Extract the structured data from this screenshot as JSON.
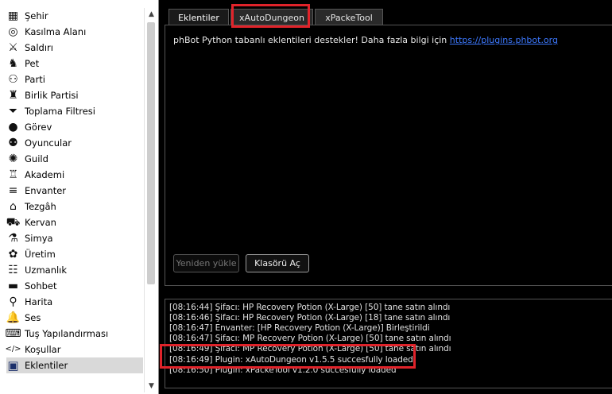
{
  "sidebar": {
    "items": [
      {
        "label": "Şehir",
        "icon": "city-icon"
      },
      {
        "label": "Kasılma Alanı",
        "icon": "target-icon"
      },
      {
        "label": "Saldırı",
        "icon": "sword-icon"
      },
      {
        "label": "Pet",
        "icon": "pet-icon"
      },
      {
        "label": "Parti",
        "icon": "party-icon"
      },
      {
        "label": "Birlik Partisi",
        "icon": "union-party-icon"
      },
      {
        "label": "Toplama Filtresi",
        "icon": "filter-icon"
      },
      {
        "label": "Görev",
        "icon": "quest-icon"
      },
      {
        "label": "Oyuncular",
        "icon": "players-icon"
      },
      {
        "label": "Guild",
        "icon": "guild-icon"
      },
      {
        "label": "Akademi",
        "icon": "academy-icon"
      },
      {
        "label": "Envanter",
        "icon": "inventory-icon"
      },
      {
        "label": "Tezgâh",
        "icon": "stall-icon"
      },
      {
        "label": "Kervan",
        "icon": "caravan-icon"
      },
      {
        "label": "Simya",
        "icon": "alchemy-icon"
      },
      {
        "label": "Üretim",
        "icon": "production-icon"
      },
      {
        "label": "Uzmanlık",
        "icon": "mastery-icon"
      },
      {
        "label": "Sohbet",
        "icon": "chat-icon"
      },
      {
        "label": "Harita",
        "icon": "map-pin-icon"
      },
      {
        "label": "Ses",
        "icon": "bell-icon"
      },
      {
        "label": "Tuş Yapılandırması",
        "icon": "hotkey-icon"
      },
      {
        "label": "Koşullar",
        "icon": "code-icon"
      },
      {
        "label": "Eklentiler",
        "icon": "plugin-icon"
      }
    ],
    "selected_index": 22
  },
  "tabs": [
    {
      "label": "Eklentiler",
      "active": true
    },
    {
      "label": "xAutoDungeon",
      "active": false
    },
    {
      "label": "xPackeTool",
      "active": false
    }
  ],
  "panel": {
    "info_text": "phBot Python tabanlı eklentileri destekler! Daha fazla bilgi için",
    "info_link": "https://plugins.phbot.org",
    "reload_button": "Yeniden yükle",
    "open_folder_button": "Klasörü Aç"
  },
  "log": [
    "[08:16:44] Şifacı: HP Recovery Potion (X-Large) [50] tane satın alındı",
    "[08:16:46] Şifacı: HP Recovery Potion (X-Large) [18] tane satın alındı",
    "[08:16:47] Envanter: [HP Recovery Potion (X-Large)] Birleştirildi",
    "[08:16:47] Şifacı: MP Recovery Potion (X-Large) [50] tane satın alındı",
    "[08:16:49] Şifacı: MP Recovery Potion (X-Large) [50] tane satın alındı",
    "[08:16:49] Plugin: xAutoDungeon v1.5.5 succesfully loaded",
    "[08:16:50] Plugin: xPackeTool v1.2.0 succesfully loaded"
  ],
  "colors": {
    "highlight": "#e0232a",
    "link": "#3d79ff",
    "background": "#000000"
  }
}
